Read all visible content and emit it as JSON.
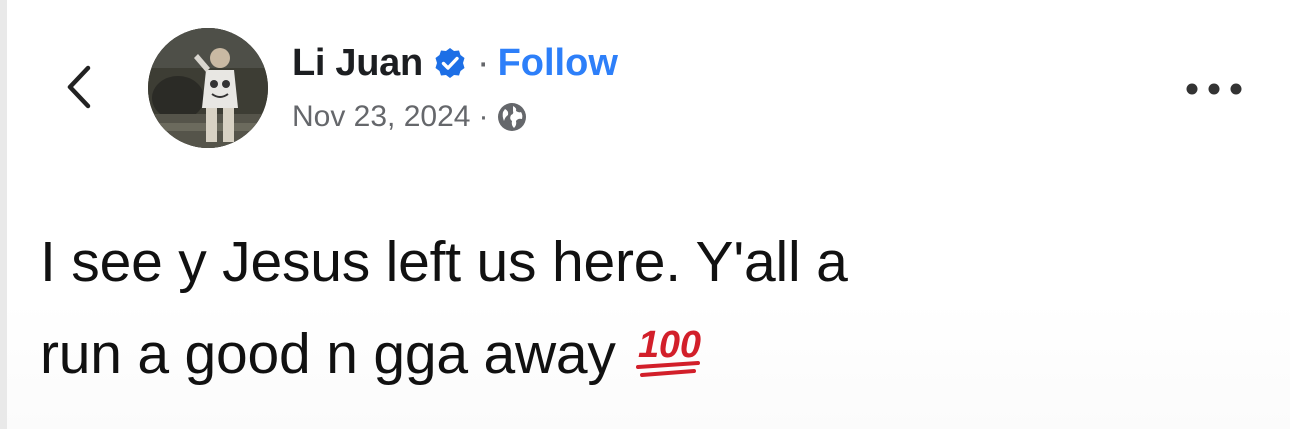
{
  "post": {
    "author": {
      "name": "Li Juan",
      "verified": true
    },
    "follow_label": "Follow",
    "name_separator": "·",
    "date": "Nov 23, 2024",
    "meta_separator": "·",
    "audience_icon": "globe-icon",
    "text_lines": [
      "I see y Jesus left us here.  Y'all a",
      "run a good n  gga away"
    ],
    "emoji_text": "100",
    "emoji_name": "hundred-points-emoji"
  },
  "icons": {
    "back": "chevron-left-icon",
    "verified": "verified-badge-icon",
    "more": "more-options-icon"
  },
  "colors": {
    "follow_link": "#2d7ff9",
    "verified_badge": "#1d6fe6",
    "meta_text": "#65676b",
    "body_text": "#111111",
    "emoji_red": "#d21f2a"
  }
}
